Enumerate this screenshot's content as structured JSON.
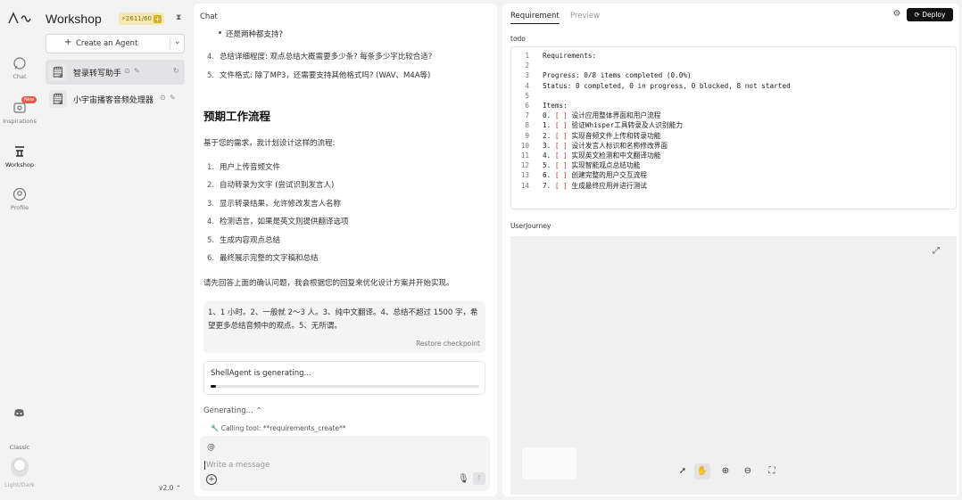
{
  "app": {
    "title": "Workshop",
    "credit": "2611/60",
    "version": "v2.0"
  },
  "rail": {
    "items": [
      {
        "label": "Chat",
        "icon": "chat-icon"
      },
      {
        "label": "Inspirations",
        "icon": "inspirations-icon",
        "badge": "New"
      },
      {
        "label": "Workshop",
        "icon": "workshop-icon"
      },
      {
        "label": "Profile",
        "icon": "profile-icon"
      }
    ],
    "mode_label": "Classic",
    "theme_label": "Light/Dark"
  },
  "sidebar": {
    "create_label": "Create an Agent",
    "agents": [
      {
        "name": "智录转写助手"
      },
      {
        "name": "小宇宙播客音频处理器"
      }
    ]
  },
  "chat": {
    "header": "Chat",
    "sub_bullet": "还是两种都支持?",
    "questions": [
      {
        "num": "4.",
        "text": "总结详细程度: 观点总结大概需要多少条? 每条多少字比较合适?"
      },
      {
        "num": "5.",
        "text": "文件格式: 除了MP3，还需要支持其他格式吗? (WAV、M4A等)"
      }
    ],
    "heading": "预期工作流程",
    "intro": "基于您的需求，我计划设计这样的流程:",
    "steps": [
      {
        "num": "1.",
        "text": "用户上传音频文件"
      },
      {
        "num": "2.",
        "text": "自动转录为文字 (尝试识别发言人)"
      },
      {
        "num": "3.",
        "text": "显示转录结果，允许修改发言人名称"
      },
      {
        "num": "4.",
        "text": "检测语言，如果是英文则提供翻译选项"
      },
      {
        "num": "5.",
        "text": "生成内容观点总结"
      },
      {
        "num": "6.",
        "text": "最终展示完整的文字稿和总结"
      }
    ],
    "closing": "请先回答上面的确认问题，我会根据您的回复来优化设计方案并开始实现。",
    "user_answer": "1、1 小时。2、一般就 2～3 人。3、纯中文翻译。4、总结不超过 1500 字，希望更多总结音频中的观点。5、无所谓。",
    "restore_label": "Restore checkpoint",
    "generating_text": "ShellAgent is generating...",
    "progress": 0.02,
    "generating_label": "Generating...",
    "calling_text": "Calling tool: **requirements_create**",
    "input_at": "@",
    "input_placeholder": "Write a message"
  },
  "right": {
    "tabs": [
      "Requirement",
      "Preview"
    ],
    "deploy_label": "Deploy",
    "todo_label": "todo",
    "todo_lines": [
      {
        "n": "1",
        "text": "Requirements:"
      },
      {
        "n": "2",
        "text": ""
      },
      {
        "n": "3",
        "text": "Progress: 0/8 items completed (0.0%)"
      },
      {
        "n": "4",
        "text": "Status: 0 completed, 0 in progress, 0 blocked, 8 not started"
      },
      {
        "n": "5",
        "text": ""
      },
      {
        "n": "6",
        "text": "Items:"
      },
      {
        "n": "7",
        "pre": "0. ",
        "cb": "[ ]",
        "text": " 设计应用整体界面和用户流程"
      },
      {
        "n": "8",
        "pre": "1. ",
        "cb": "[ ]",
        "text": " 验证Whisper工具转录及人识别能力"
      },
      {
        "n": "9",
        "pre": "2. ",
        "cb": "[ ]",
        "text": " 实现音频文件上传和转录功能"
      },
      {
        "n": "10",
        "pre": "3. ",
        "cb": "[ ]",
        "text": " 设计发言人标识和名称修改界面"
      },
      {
        "n": "11",
        "pre": "4. ",
        "cb": "[ ]",
        "text": " 实现英文检测和中文翻译功能"
      },
      {
        "n": "12",
        "pre": "5. ",
        "cb": "[ ]",
        "text": " 实现智能观点总结功能"
      },
      {
        "n": "13",
        "pre": "6. ",
        "cb": "[ ]",
        "text": " 创建完整的用户交互流程"
      },
      {
        "n": "14",
        "pre": "7. ",
        "cb": "[ ]",
        "text": " 生成最终应用并进行测试"
      }
    ],
    "journey_label": "UserJourney"
  }
}
